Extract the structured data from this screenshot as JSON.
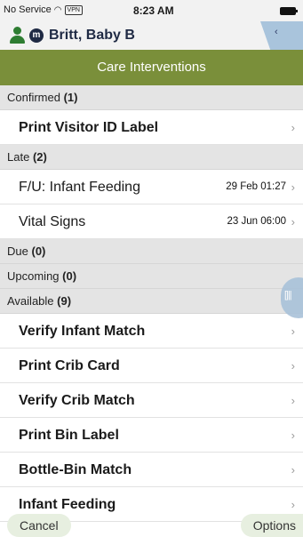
{
  "status_bar": {
    "carrier": "No Service",
    "vpn": "VPN",
    "time": "8:23 AM"
  },
  "patient": {
    "badge": "m",
    "name": "Britt, Baby B"
  },
  "title": "Care Interventions",
  "sections": {
    "confirmed": {
      "label": "Confirmed",
      "count": "(1)"
    },
    "late": {
      "label": "Late",
      "count": "(2)"
    },
    "due": {
      "label": "Due",
      "count": "(0)"
    },
    "upcoming": {
      "label": "Upcoming",
      "count": "(0)"
    },
    "available": {
      "label": "Available",
      "count": "(9)"
    }
  },
  "confirmed_items": [
    {
      "label": "Print Visitor ID Label"
    }
  ],
  "late_items": [
    {
      "label": "F/U: Infant Feeding",
      "date": "29 Feb 01:27"
    },
    {
      "label": "Vital Signs",
      "date": "23 Jun 06:00"
    }
  ],
  "available_items": [
    {
      "label": "Verify Infant Match"
    },
    {
      "label": "Print Crib Card"
    },
    {
      "label": "Verify Crib Match"
    },
    {
      "label": "Print Bin Label"
    },
    {
      "label": "Bottle-Bin Match"
    },
    {
      "label": "Infant Feeding"
    }
  ],
  "footer": {
    "cancel": "Cancel",
    "options": "Options"
  },
  "colors": {
    "title_bar": "#7a8f3a",
    "section_header": "#e4e4e4",
    "footer_button": "#e7efe0",
    "patient_icon": "#2e7d32"
  },
  "icons": {
    "wifi": "wifi-icon",
    "battery": "battery-icon",
    "person": "person-icon",
    "collapse": "chevron-left-icon",
    "scan": "barcode-icon",
    "row_chevron": "chevron-right-icon"
  }
}
